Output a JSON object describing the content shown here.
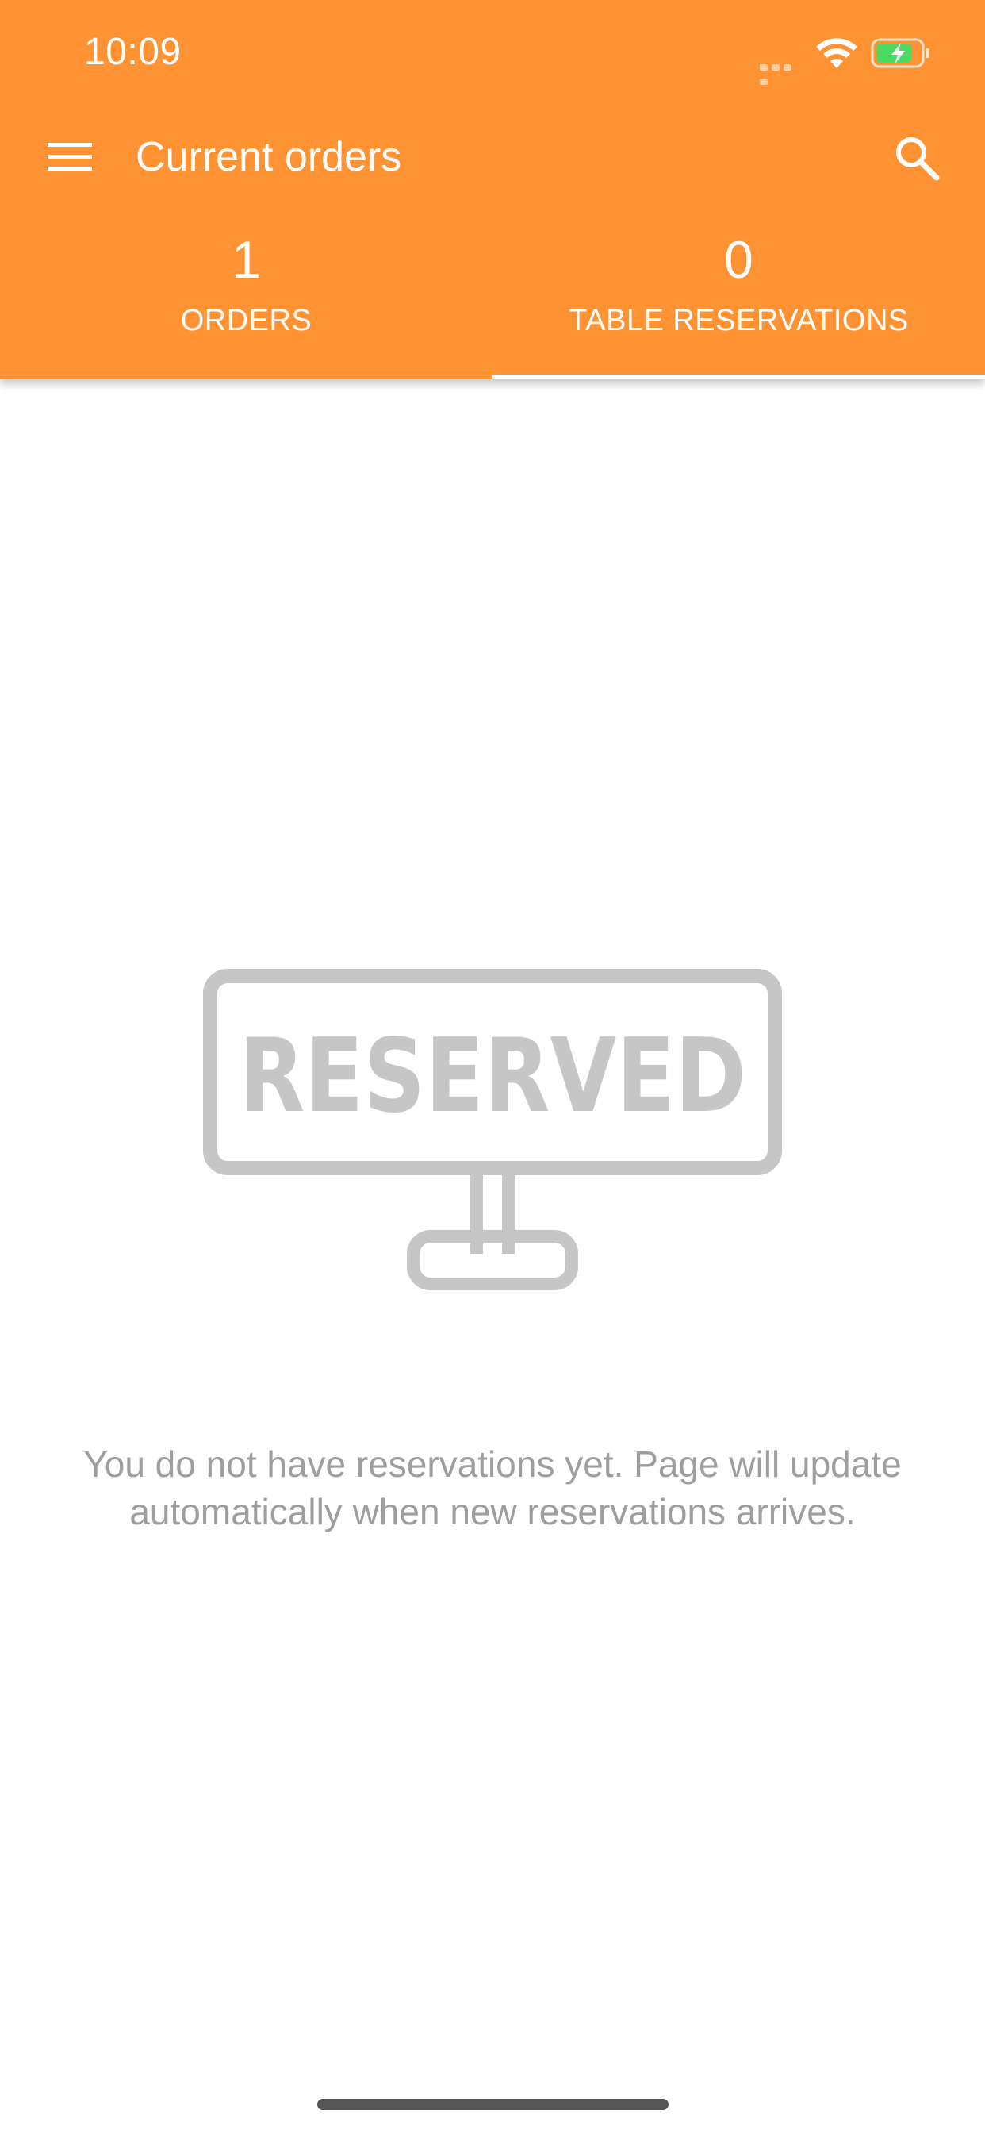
{
  "status_bar": {
    "time": "10:09"
  },
  "toolbar": {
    "title": "Current orders",
    "menu_icon": "hamburger-menu-icon",
    "search_icon": "search-icon"
  },
  "tabs": [
    {
      "count": "1",
      "label": "ORDERS",
      "selected": false
    },
    {
      "count": "0",
      "label": "TABLE RESERVATIONS",
      "selected": true
    }
  ],
  "empty_state": {
    "sign_text": "RESERVED",
    "message": "You do not have reservations yet. Page will update automatically when new reservations arrives."
  },
  "colors": {
    "accent": "#FF9233",
    "muted_text": "#9E9E9E",
    "illustration": "#C6C6C6"
  }
}
